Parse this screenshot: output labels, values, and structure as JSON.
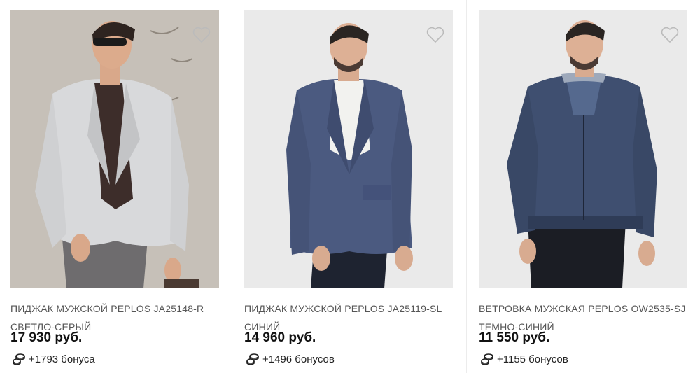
{
  "products": [
    {
      "name_line1": "ПИДЖАК МУЖСКОЙ PEPLOS JA25148-R",
      "name_line2": "СВЕТЛО-СЕРЫЙ",
      "price": "17 930 руб.",
      "bonus": "+1793 бонуса",
      "favorite_icon": "heart-outline-icon",
      "bonus_icon": "coins-icon"
    },
    {
      "name_line1": "ПИДЖАК МУЖСКОЙ PEPLOS JA25119-SL",
      "name_line2": "СИНИЙ",
      "price": "14 960 руб.",
      "bonus": "+1496 бонусов",
      "favorite_icon": "heart-outline-icon",
      "bonus_icon": "coins-icon"
    },
    {
      "name_line1": "ВЕТРОВКА МУЖСКАЯ PEPLOS OW2535-SJ",
      "name_line2": "ТЕМНО-СИНИЙ",
      "price": "11 550 руб.",
      "bonus": "+1155 бонусов",
      "favorite_icon": "heart-outline-icon",
      "bonus_icon": "coins-icon"
    }
  ],
  "colors": {
    "background": "#ffffff",
    "name_text": "#555555",
    "price_text": "#111111",
    "heart_stroke": "#bbbbbb"
  }
}
